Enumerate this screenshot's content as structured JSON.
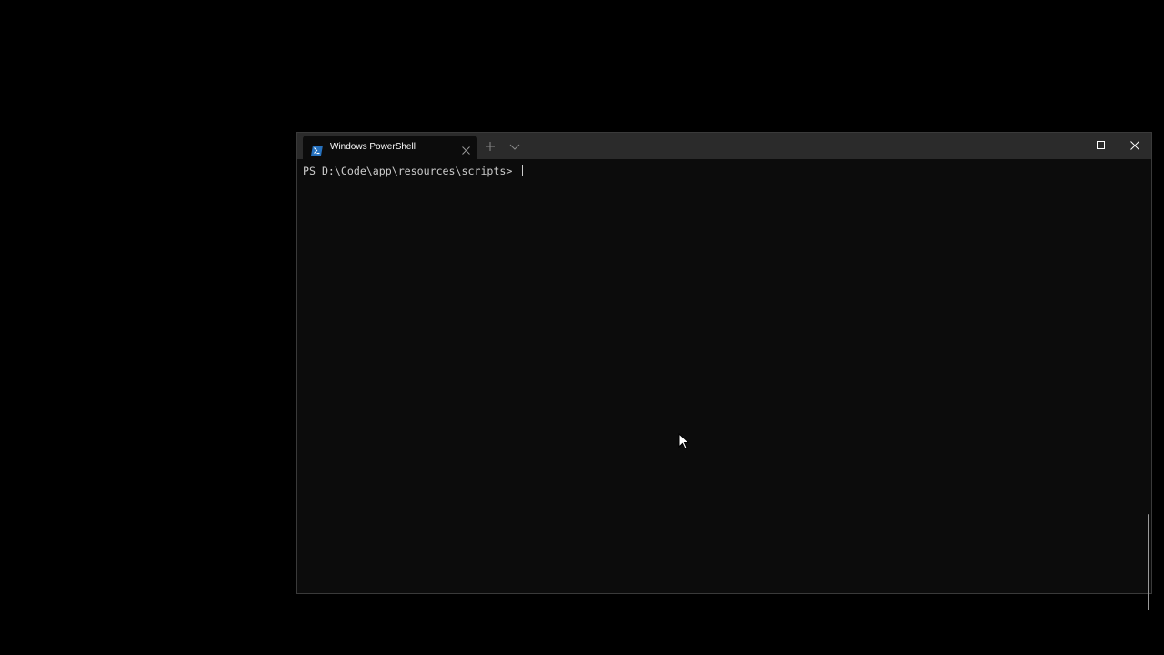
{
  "window": {
    "tab_title": "Windows PowerShell",
    "tab_icon": "powershell-icon"
  },
  "titlebar": {
    "new_tab_icon": "plus-icon",
    "dropdown_icon": "chevron-down-icon",
    "minimize_icon": "minimize-icon",
    "maximize_icon": "maximize-icon",
    "close_icon": "close-icon"
  },
  "terminal": {
    "prompt": "PS D:\\Code\\app\\resources\\scripts> "
  },
  "colors": {
    "background": "#0c0c0c",
    "titlebar": "#2b2b2b",
    "text": "#cccccc",
    "powershell_blue": "#2671be"
  }
}
